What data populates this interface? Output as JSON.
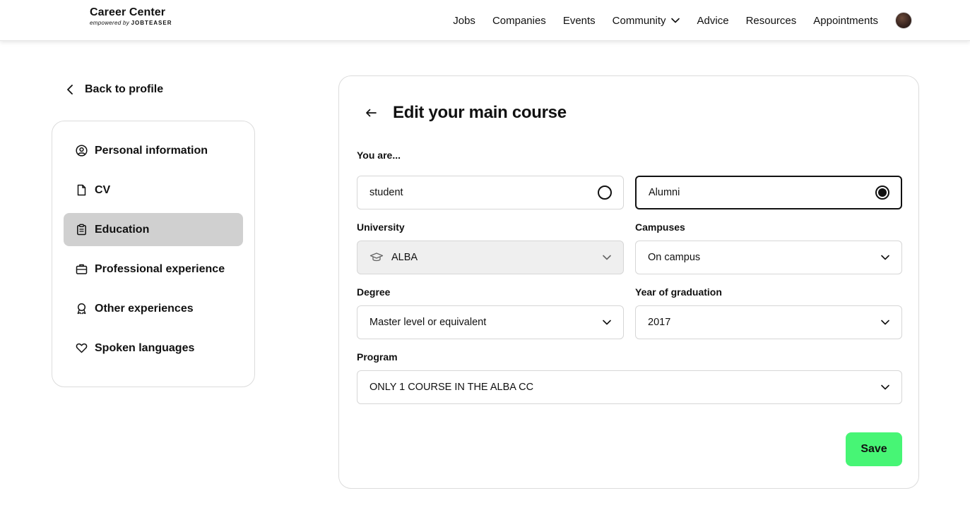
{
  "header": {
    "brand_title": "Career Center",
    "brand_sub_prefix": "empowered by",
    "brand_sub_name": "JOBTEASER",
    "nav": [
      "Jobs",
      "Companies",
      "Events",
      "Community",
      "Advice",
      "Resources",
      "Appointments"
    ]
  },
  "back_link": "Back to profile",
  "sidebar": {
    "items": [
      {
        "label": "Personal information",
        "icon": "user-circle-icon"
      },
      {
        "label": "CV",
        "icon": "document-icon"
      },
      {
        "label": "Education",
        "icon": "clipboard-icon",
        "active": true
      },
      {
        "label": "Professional experience",
        "icon": "briefcase-icon"
      },
      {
        "label": "Other experiences",
        "icon": "award-icon"
      },
      {
        "label": "Spoken languages",
        "icon": "heart-icon"
      }
    ]
  },
  "form": {
    "title": "Edit your main course",
    "you_are_label": "You are...",
    "options": [
      {
        "label": "student",
        "selected": false
      },
      {
        "label": "Alumni",
        "selected": true
      }
    ],
    "university_label": "University",
    "university_value": "ALBA",
    "campuses_label": "Campuses",
    "campuses_value": "On campus",
    "degree_label": "Degree",
    "degree_value": "Master level or equivalent",
    "year_label": "Year of graduation",
    "year_value": "2017",
    "program_label": "Program",
    "program_value": "ONLY 1 COURSE IN THE ALBA CC",
    "save_label": "Save"
  },
  "colors": {
    "save_button": "#47f575",
    "active_sidebar": "#d0d0d0",
    "disabled_field": "#efefef"
  }
}
